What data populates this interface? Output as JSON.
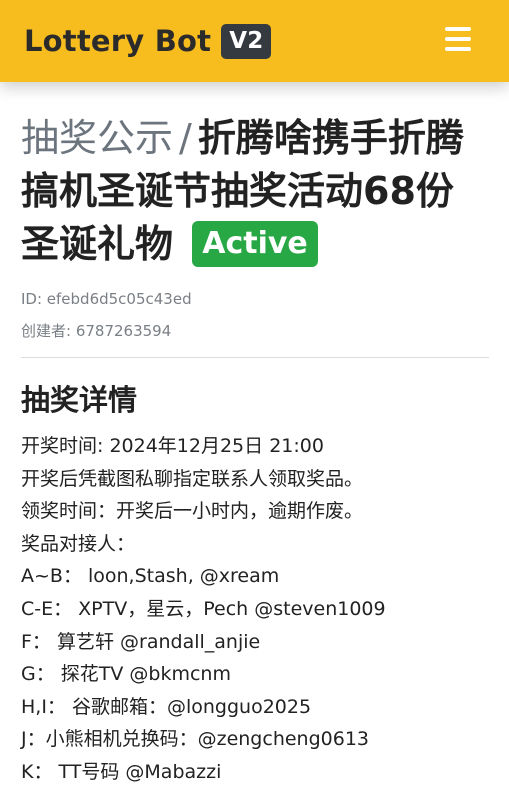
{
  "navbar": {
    "brand": "Lottery Bot",
    "version_badge": "V2",
    "menu_icon": "hamburger-menu-icon"
  },
  "header": {
    "breadcrumb": "抽奖公示",
    "separator": "/",
    "title": "折腾啥携手折腾搞机圣诞节抽奖活动68份圣诞礼物",
    "status": "Active",
    "id_line": "ID: efebd6d5c05c43ed",
    "creator_line": "创建者: 6787263594"
  },
  "details": {
    "heading": "抽奖详情",
    "lines": [
      "开奖时间: 2024年12月25日 21:00",
      "开奖后凭截图私聊指定联系人领取奖品。",
      "领奖时间：开奖后一小时内，逾期作废。",
      "奖品对接人：",
      "A~B： loon,Stash, @xream",
      "C-E： XPTV，星云，Pech @steven1009",
      "F： 算艺轩 @randall_anjie",
      "G： 探花TV @bkmcnm",
      "H,I： 谷歌邮箱：@longguo2025",
      "J：小熊相机兑换码：@zengcheng0613",
      "K： TT号码 @Mabazzi"
    ]
  },
  "colors": {
    "navbar": "#f7bd1f",
    "badge_dark": "#343a40",
    "status_green": "#28a745"
  }
}
